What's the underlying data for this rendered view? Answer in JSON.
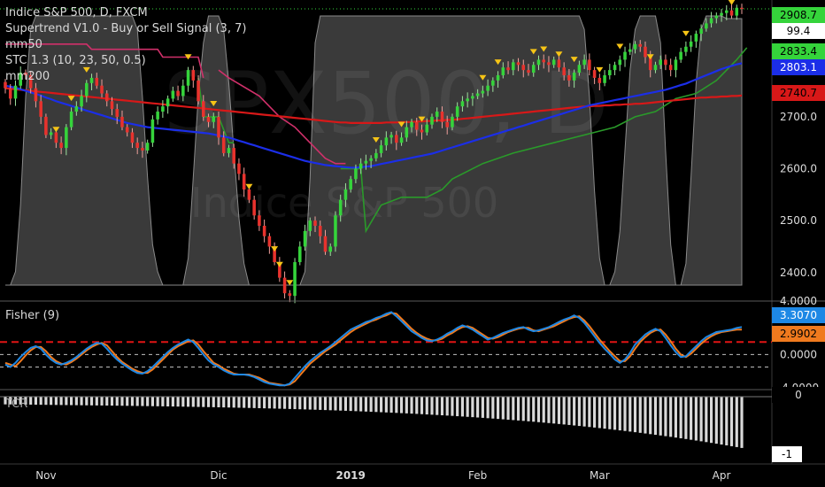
{
  "chart_data": {
    "type": "candlestick",
    "symbol_title": "Indice S&P 500, D, FXCM",
    "watermark": {
      "ticker": "SPX500, D",
      "name": "Indice S&P 500"
    },
    "x_axis": {
      "labels": [
        "Nov",
        "Dic",
        "2019",
        "Feb",
        "Mar",
        "Apr"
      ],
      "label_index": [
        8,
        42,
        68,
        93,
        117,
        141
      ]
    },
    "price_axis": {
      "range": [
        2345,
        2925
      ],
      "ticks": [
        2400.0,
        2500.0,
        2600.0,
        2700.0
      ],
      "tick_labels": [
        "2400.0",
        "2500.0",
        "2600.0",
        "2700.0"
      ]
    },
    "indicators": [
      "Supertrend V1.0 - Buy or Sell Signal (3, 7)",
      "mm50",
      "STC 1.3 (10, 23, 50, 0.5)",
      "mm200"
    ],
    "last_values": {
      "price": "2908.7",
      "stc": "99.4",
      "supertrend": "2833.4",
      "mm50": "2803.1",
      "mm200": "2740.7",
      "fisher": "3.3070",
      "fisher_trigger": "2.9902",
      "tcr": "0",
      "tcr_min": "-1"
    },
    "colors": {
      "up": "#35d43b",
      "down": "#e8322d",
      "mm50": "#1b2ee8",
      "mm200": "#d81818",
      "supertrend_up": "#2a9a2a",
      "supertrend_down": "#d0306a",
      "stc_fill": "#6a6a6a",
      "fisher": "#1e88e5",
      "fisher_trigger": "#f07a1e",
      "signal_marker": "#f6c416"
    },
    "price_closes": [
      2755,
      2735,
      2760,
      2785,
      2780,
      2755,
      2730,
      2700,
      2665,
      2670,
      2650,
      2640,
      2680,
      2710,
      2720,
      2740,
      2765,
      2775,
      2760,
      2745,
      2730,
      2715,
      2700,
      2680,
      2670,
      2650,
      2640,
      2635,
      2650,
      2695,
      2710,
      2720,
      2735,
      2750,
      2740,
      2760,
      2790,
      2770,
      2730,
      2700,
      2690,
      2700,
      2660,
      2630,
      2640,
      2610,
      2590,
      2560,
      2540,
      2510,
      2490,
      2470,
      2450,
      2420,
      2390,
      2360,
      2355,
      2420,
      2450,
      2480,
      2500,
      2490,
      2470,
      2440,
      2450,
      2510,
      2540,
      2560,
      2580,
      2600,
      2610,
      2615,
      2620,
      2630,
      2645,
      2660,
      2665,
      2650,
      2660,
      2680,
      2690,
      2675,
      2670,
      2685,
      2700,
      2710,
      2690,
      2680,
      2700,
      2720,
      2730,
      2735,
      2740,
      2745,
      2750,
      2760,
      2770,
      2780,
      2795,
      2790,
      2805,
      2800,
      2790,
      2785,
      2800,
      2810,
      2805,
      2800,
      2810,
      2795,
      2780,
      2770,
      2785,
      2800,
      2810,
      2790,
      2775,
      2765,
      2780,
      2790,
      2800,
      2810,
      2825,
      2830,
      2840,
      2835,
      2815,
      2790,
      2800,
      2810,
      2800,
      2790,
      2810,
      2825,
      2835,
      2845,
      2860,
      2870,
      2880,
      2890,
      2895,
      2900,
      2905,
      2895,
      2910,
      2908
    ],
    "mm50": [
      2760,
      2758,
      2756,
      2753,
      2750,
      2747,
      2744,
      2741,
      2737,
      2734,
      2730,
      2727,
      2724,
      2721,
      2718,
      2715,
      2712,
      2709,
      2706,
      2703,
      2700,
      2697,
      2694,
      2691,
      2688,
      2686,
      2684,
      2682,
      2680,
      2679,
      2678,
      2677,
      2676,
      2675,
      2674,
      2673,
      2672,
      2671,
      2670,
      2669,
      2668,
      2666,
      2664,
      2662,
      2660,
      2657,
      2654,
      2651,
      2648,
      2645,
      2642,
      2639,
      2636,
      2633,
      2630,
      2627,
      2624,
      2621,
      2618,
      2615,
      2613,
      2611,
      2609,
      2607,
      2606,
      2605,
      2604,
      2603,
      2602,
      2602,
      2603,
      2604,
      2605,
      2607,
      2609,
      2611,
      2613,
      2615,
      2617,
      2619,
      2621,
      2623,
      2625,
      2627,
      2629,
      2632,
      2635,
      2638,
      2641,
      2644,
      2647,
      2650,
      2653,
      2656,
      2659,
      2662,
      2665,
      2668,
      2671,
      2674,
      2677,
      2680,
      2683,
      2686,
      2689,
      2692,
      2695,
      2698,
      2701,
      2704,
      2707,
      2710,
      2713,
      2716,
      2719,
      2722,
      2724,
      2726,
      2728,
      2730,
      2732,
      2734,
      2736,
      2738,
      2740,
      2742,
      2744,
      2746,
      2748,
      2750,
      2752,
      2755,
      2758,
      2761,
      2764,
      2768,
      2772,
      2776,
      2780,
      2784,
      2788,
      2792,
      2795,
      2798,
      2801,
      2803
    ],
    "mm200": [
      2755,
      2754,
      2753,
      2752,
      2751,
      2750,
      2749,
      2748,
      2747,
      2746,
      2745,
      2744,
      2743,
      2742,
      2741,
      2740,
      2739,
      2738,
      2737,
      2736,
      2735,
      2734,
      2733,
      2732,
      2731,
      2730,
      2729,
      2728,
      2727,
      2726,
      2725,
      2724,
      2723,
      2722,
      2721,
      2720,
      2719,
      2718,
      2717,
      2716,
      2715,
      2714,
      2713,
      2712,
      2711,
      2710,
      2709,
      2708,
      2707,
      2706,
      2705,
      2704,
      2703,
      2702,
      2701,
      2700,
      2699,
      2698,
      2697,
      2696,
      2695,
      2694,
      2693,
      2692,
      2691,
      2690,
      2689,
      2689,
      2688,
      2688,
      2688,
      2688,
      2688,
      2688,
      2688,
      2689,
      2689,
      2689,
      2690,
      2690,
      2690,
      2691,
      2691,
      2692,
      2692,
      2693,
      2693,
      2694,
      2694,
      2695,
      2696,
      2697,
      2698,
      2699,
      2700,
      2701,
      2702,
      2703,
      2704,
      2705,
      2706,
      2707,
      2708,
      2709,
      2710,
      2711,
      2712,
      2713,
      2714,
      2715,
      2716,
      2717,
      2718,
      2719,
      2720,
      2720,
      2721,
      2721,
      2722,
      2722,
      2723,
      2723,
      2724,
      2724,
      2725,
      2725,
      2726,
      2727,
      2728,
      2729,
      2730,
      2731,
      2732,
      2733,
      2734,
      2735,
      2736,
      2737,
      2737,
      2738,
      2738,
      2739,
      2739,
      2740,
      2740,
      2741
    ],
    "supertrend": {
      "segments": [
        {
          "trend": "down",
          "points": [
            [
              0,
              2840
            ],
            [
              16,
              2840
            ],
            [
              17,
              2830
            ],
            [
              30,
              2830
            ],
            [
              31,
              2815
            ],
            [
              38,
              2815
            ],
            [
              39,
              2775
            ]
          ]
        },
        {
          "trend": "down",
          "points": [
            [
              42,
              2790
            ],
            [
              44,
              2775
            ],
            [
              50,
              2740
            ],
            [
              54,
              2700
            ],
            [
              57,
              2680
            ],
            [
              59,
              2660
            ],
            [
              61,
              2640
            ],
            [
              63,
              2620
            ],
            [
              65,
              2610
            ],
            [
              67,
              2610
            ]
          ]
        },
        {
          "trend": "up",
          "points": [
            [
              38,
              2775
            ],
            [
              39,
              2700
            ],
            [
              42,
              2700
            ],
            [
              44,
              2650
            ],
            [
              45,
              2650
            ]
          ]
        },
        {
          "trend": "up",
          "points": [
            [
              66,
              2600
            ],
            [
              70,
              2600
            ],
            [
              71,
              2480
            ],
            [
              74,
              2530
            ],
            [
              78,
              2545
            ],
            [
              83,
              2545
            ],
            [
              86,
              2560
            ],
            [
              88,
              2580
            ],
            [
              94,
              2610
            ],
            [
              100,
              2630
            ],
            [
              108,
              2650
            ],
            [
              116,
              2670
            ],
            [
              120,
              2680
            ],
            [
              124,
              2700
            ],
            [
              128,
              2710
            ],
            [
              132,
              2735
            ],
            [
              136,
              2745
            ],
            [
              140,
              2770
            ],
            [
              144,
              2810
            ],
            [
              146,
              2833
            ]
          ]
        }
      ]
    },
    "stc": [
      0,
      0,
      5,
      30,
      70,
      95,
      100,
      100,
      100,
      100,
      100,
      100,
      100,
      100,
      100,
      100,
      100,
      100,
      100,
      100,
      100,
      100,
      100,
      100,
      100,
      100,
      95,
      70,
      40,
      15,
      5,
      0,
      0,
      0,
      0,
      0,
      10,
      40,
      70,
      90,
      100,
      100,
      100,
      95,
      75,
      50,
      25,
      8,
      0,
      0,
      0,
      0,
      0,
      0,
      0,
      0,
      0,
      0,
      0,
      5,
      40,
      90,
      100,
      100,
      100,
      100,
      100,
      100,
      100,
      100,
      100,
      100,
      100,
      100,
      100,
      100,
      100,
      100,
      100,
      100,
      100,
      100,
      100,
      100,
      100,
      100,
      100,
      100,
      100,
      100,
      100,
      100,
      100,
      100,
      100,
      100,
      100,
      100,
      100,
      100,
      100,
      100,
      100,
      100,
      100,
      100,
      100,
      100,
      100,
      100,
      100,
      100,
      100,
      100,
      95,
      70,
      35,
      10,
      0,
      0,
      5,
      20,
      50,
      80,
      95,
      100,
      100,
      100,
      100,
      90,
      50,
      15,
      0,
      0,
      8,
      40,
      75,
      95,
      100,
      100,
      100,
      100,
      99,
      99,
      99,
      99
    ],
    "fisher": [
      -1.2,
      -1.5,
      -1.0,
      -0.3,
      0.3,
      0.8,
      1.0,
      0.7,
      0.0,
      -0.6,
      -1.0,
      -1.2,
      -1.0,
      -0.7,
      -0.3,
      0.2,
      0.7,
      1.1,
      1.4,
      1.3,
      0.7,
      0.0,
      -0.6,
      -1.1,
      -1.5,
      -1.9,
      -2.2,
      -2.3,
      -2.0,
      -1.5,
      -0.9,
      -0.3,
      0.3,
      0.8,
      1.2,
      1.5,
      1.8,
      1.5,
      0.8,
      0.0,
      -0.7,
      -1.2,
      -1.5,
      -1.9,
      -2.2,
      -2.4,
      -2.4,
      -2.4,
      -2.5,
      -2.7,
      -3.0,
      -3.3,
      -3.5,
      -3.6,
      -3.7,
      -3.7,
      -3.5,
      -2.8,
      -2.1,
      -1.4,
      -0.8,
      -0.3,
      0.2,
      0.6,
      1.0,
      1.5,
      2.0,
      2.5,
      3.0,
      3.3,
      3.6,
      3.9,
      4.1,
      4.4,
      4.6,
      4.9,
      5.1,
      4.6,
      4.0,
      3.4,
      2.8,
      2.4,
      2.0,
      1.7,
      1.6,
      1.8,
      2.1,
      2.5,
      2.8,
      3.2,
      3.5,
      3.3,
      3.0,
      2.6,
      2.2,
      1.8,
      2.0,
      2.3,
      2.6,
      2.8,
      3.0,
      3.2,
      3.3,
      3.0,
      2.8,
      2.9,
      3.1,
      3.3,
      3.6,
      3.9,
      4.2,
      4.4,
      4.7,
      4.4,
      3.8,
      3.0,
      2.2,
      1.4,
      0.7,
      0.1,
      -0.6,
      -1.0,
      -0.6,
      0.2,
      1.2,
      1.8,
      2.4,
      2.8,
      3.1,
      2.8,
      2.0,
      1.1,
      0.3,
      -0.3,
      -0.2,
      0.4,
      1.0,
      1.6,
      2.1,
      2.4,
      2.7,
      2.8,
      2.9,
      3.0,
      3.2,
      3.3
    ],
    "fisher_trigger": [
      -1.0,
      -1.2,
      -1.4,
      -0.8,
      -0.1,
      0.5,
      0.9,
      0.9,
      0.4,
      -0.3,
      -0.8,
      -1.1,
      -1.2,
      -0.9,
      -0.5,
      0.0,
      0.5,
      0.9,
      1.2,
      1.4,
      1.1,
      0.4,
      -0.3,
      -0.9,
      -1.3,
      -1.7,
      -2.0,
      -2.2,
      -2.2,
      -1.8,
      -1.2,
      -0.6,
      0.0,
      0.6,
      1.0,
      1.3,
      1.6,
      1.7,
      1.2,
      0.4,
      -0.3,
      -1.0,
      -1.3,
      -1.7,
      -2.0,
      -2.3,
      -2.4,
      -2.4,
      -2.4,
      -2.6,
      -2.8,
      -3.1,
      -3.4,
      -3.5,
      -3.6,
      -3.7,
      -3.6,
      -3.2,
      -2.5,
      -1.8,
      -1.1,
      -0.6,
      -0.1,
      0.4,
      0.8,
      1.2,
      1.7,
      2.2,
      2.7,
      3.1,
      3.4,
      3.7,
      4.0,
      4.2,
      4.5,
      4.7,
      5.0,
      4.9,
      4.3,
      3.7,
      3.1,
      2.6,
      2.2,
      1.9,
      1.7,
      1.7,
      1.9,
      2.3,
      2.6,
      3.0,
      3.3,
      3.4,
      3.2,
      2.8,
      2.4,
      2.0,
      1.9,
      2.1,
      2.4,
      2.7,
      2.9,
      3.1,
      3.2,
      3.2,
      2.9,
      2.8,
      3.0,
      3.2,
      3.4,
      3.7,
      4.0,
      4.3,
      4.5,
      4.6,
      4.1,
      3.4,
      2.6,
      1.8,
      1.1,
      0.4,
      -0.2,
      -0.8,
      -0.8,
      -0.2,
      0.7,
      1.5,
      2.1,
      2.6,
      2.9,
      3.0,
      2.4,
      1.6,
      0.7,
      0.0,
      -0.3,
      0.1,
      0.7,
      1.3,
      1.8,
      2.2,
      2.5,
      2.7,
      2.8,
      2.9,
      3.0,
      3.0
    ],
    "fisher_axis": {
      "range": [
        -4.0,
        6.0
      ],
      "ticks": [
        0.0,
        -4.0
      ],
      "tick_labels": [
        "0.0000",
        "-4.0000"
      ],
      "top_partial_label": "4.0000",
      "dashed_levels": [
        1.5,
        0.0,
        -1.5
      ],
      "red_level": 1.5
    },
    "tcr_axis": {
      "range": [
        -1.05,
        0.0
      ],
      "ticks": [
        0,
        -1
      ],
      "tick_labels": [
        "0",
        "-1"
      ]
    },
    "tcr_label": "TCR"
  },
  "ui": {
    "panel_fisher_title": "Fisher (9)"
  }
}
